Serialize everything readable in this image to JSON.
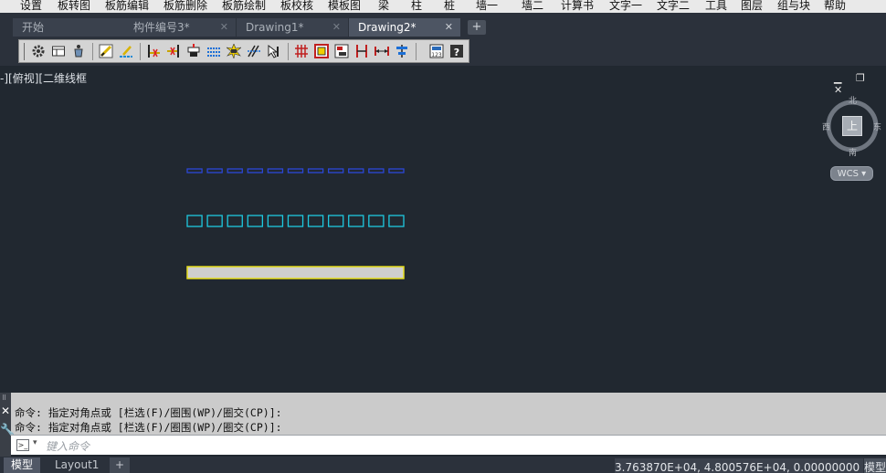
{
  "menu": [
    "设置",
    "板转图",
    "板筋编辑",
    "板筋删除",
    "板筋绘制",
    "板校核",
    "模板图",
    "梁",
    "柱",
    "桩",
    "墙一",
    "墙二",
    "计算书",
    "文字一",
    "文字二",
    "工具",
    "图层",
    "组与块",
    "帮助"
  ],
  "tabs": [
    {
      "label": "开始",
      "closable": false,
      "active": false
    },
    {
      "label": "构件编号3*",
      "closable": true,
      "active": false
    },
    {
      "label": "Drawing1*",
      "closable": true,
      "active": false
    },
    {
      "label": "Drawing2*",
      "closable": true,
      "active": true
    }
  ],
  "tab_add_label": "+",
  "toolbar_icons": [
    "gear-icon",
    "table-icon",
    "bucket-icon",
    "pen-icon",
    "edit-rebar-icon",
    "cut-icon",
    "insert-icon",
    "stack-icon",
    "dotted-list-icon",
    "burst-icon",
    "rebar-dist-icon",
    "cursor-icon",
    "grid-icon",
    "frame-icon",
    "export-icon",
    "dimension-icon",
    "span-icon",
    "align-icon",
    "calc-icon",
    "help-icon"
  ],
  "viewport": {
    "label": "-][俯视][二维线框",
    "window_controls": "▁ ❐ ✕",
    "viewcube": {
      "north": "北",
      "south": "南",
      "east": "东",
      "west": "西",
      "face": "上"
    },
    "wcs_label": "WCS ▾",
    "colors": {
      "background": "#212830",
      "blue_dashes": "#2b47d6",
      "cyan_dashes": "#1ec9df",
      "slab_fill": "#cfcfcf",
      "slab_outline": "#e4dc1a"
    }
  },
  "command": {
    "history": [
      "命令: 指定对角点或 [栏选(F)/圈围(WP)/圈交(CP)]:",
      "命令: 指定对角点或 [栏选(F)/圈围(WP)/圈交(CP)]:"
    ],
    "placeholder": "键入命令"
  },
  "status": {
    "layout_tabs": [
      {
        "label": "模型",
        "active": true
      },
      {
        "label": "Layout1",
        "active": false
      }
    ],
    "add_label": "+",
    "coordinates": "3.763870E+04, 4.800576E+04, 0.00000000",
    "mode": "模型"
  }
}
